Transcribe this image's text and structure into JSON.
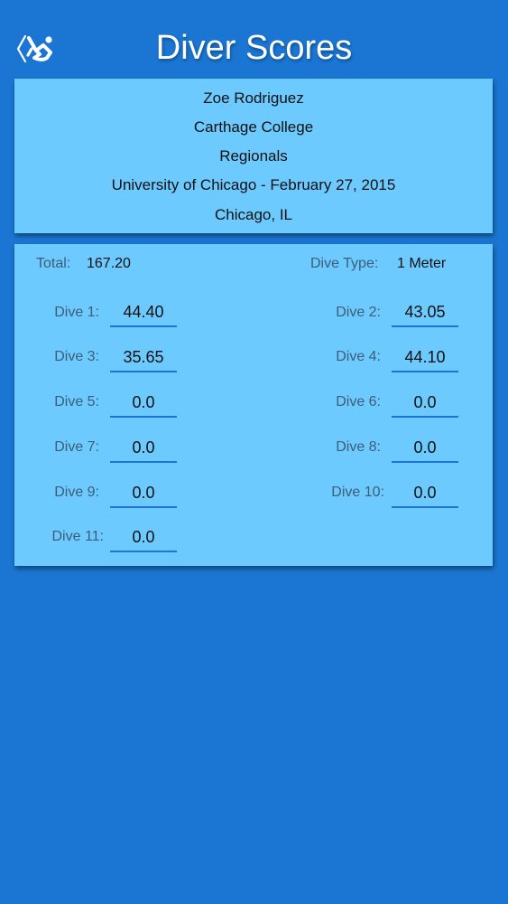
{
  "navbar": {
    "title": "Diver Scores",
    "back_icon": "diver-back-icon"
  },
  "diver": {
    "name": "Zoe Rodriguez",
    "school": "Carthage College",
    "meet": "Regionals",
    "venue_date": "University of Chicago - February 27, 2015",
    "location": "Chicago, IL"
  },
  "summary": {
    "total_label": "Total:",
    "total_value": "167.20",
    "dive_type_label": "Dive Type:",
    "dive_type_value": "1 Meter"
  },
  "dives": [
    {
      "label": "Dive 1:",
      "score": "44.40"
    },
    {
      "label": "Dive 2:",
      "score": "43.05"
    },
    {
      "label": "Dive 3:",
      "score": "35.65"
    },
    {
      "label": "Dive 4:",
      "score": "44.10"
    },
    {
      "label": "Dive 5:",
      "score": "0.0"
    },
    {
      "label": "Dive 6:",
      "score": "0.0"
    },
    {
      "label": "Dive 7:",
      "score": "0.0"
    },
    {
      "label": "Dive 8:",
      "score": "0.0"
    },
    {
      "label": "Dive 9:",
      "score": "0.0"
    },
    {
      "label": "Dive 10:",
      "score": "0.0"
    },
    {
      "label": "Dive 11:",
      "score": "0.0"
    }
  ],
  "colors": {
    "background": "#1a76d2",
    "card": "#6ccaff",
    "underline": "#1a76d2",
    "label": "#3d5d78"
  }
}
